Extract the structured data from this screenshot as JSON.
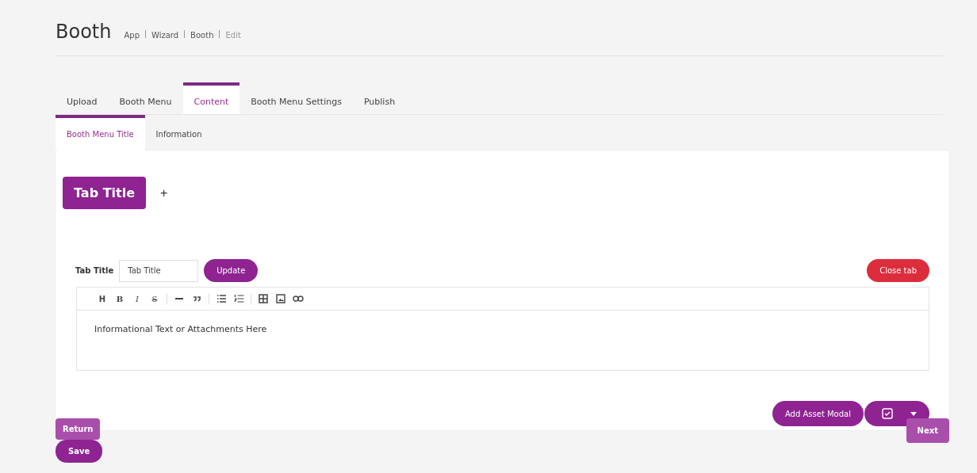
{
  "page": {
    "title": "Booth",
    "breadcrumb": [
      {
        "label": "App",
        "current": false
      },
      {
        "label": "Wizard",
        "current": false
      },
      {
        "label": "Booth",
        "current": false
      },
      {
        "label": "Edit",
        "current": true
      }
    ]
  },
  "tabs": [
    {
      "label": "Upload",
      "selected": false
    },
    {
      "label": "Booth Menu",
      "selected": false
    },
    {
      "label": "Content",
      "selected": true
    },
    {
      "label": "Booth Menu Settings",
      "selected": false
    },
    {
      "label": "Publish",
      "selected": false
    }
  ],
  "subtabs": [
    {
      "label": "Booth Menu Title",
      "selected": true
    },
    {
      "label": "Information",
      "selected": false
    }
  ],
  "content_tabs": [
    {
      "label": "Tab Title",
      "selected": true
    }
  ],
  "add_tab": "+",
  "form": {
    "label": "Tab Title",
    "value": "Tab Title",
    "update": "Update",
    "close": "Close tab"
  },
  "toolbar": [
    {
      "kind": "heading",
      "label": "H"
    },
    {
      "kind": "bold",
      "label": "B"
    },
    {
      "kind": "italic",
      "label": "I"
    },
    {
      "kind": "strikethrough",
      "label": "S"
    },
    {
      "kind": "separator"
    },
    {
      "kind": "rule"
    },
    {
      "kind": "quote"
    },
    {
      "kind": "separator"
    },
    {
      "kind": "bullet-list"
    },
    {
      "kind": "numbered-list"
    },
    {
      "kind": "separator"
    },
    {
      "kind": "table"
    },
    {
      "kind": "image"
    },
    {
      "kind": "link"
    }
  ],
  "editor_text": "Informational Text or Attachments Here",
  "add_asset": "Add Asset Modal",
  "footer": {
    "return": "Return",
    "save": "Save",
    "next": "Next"
  }
}
